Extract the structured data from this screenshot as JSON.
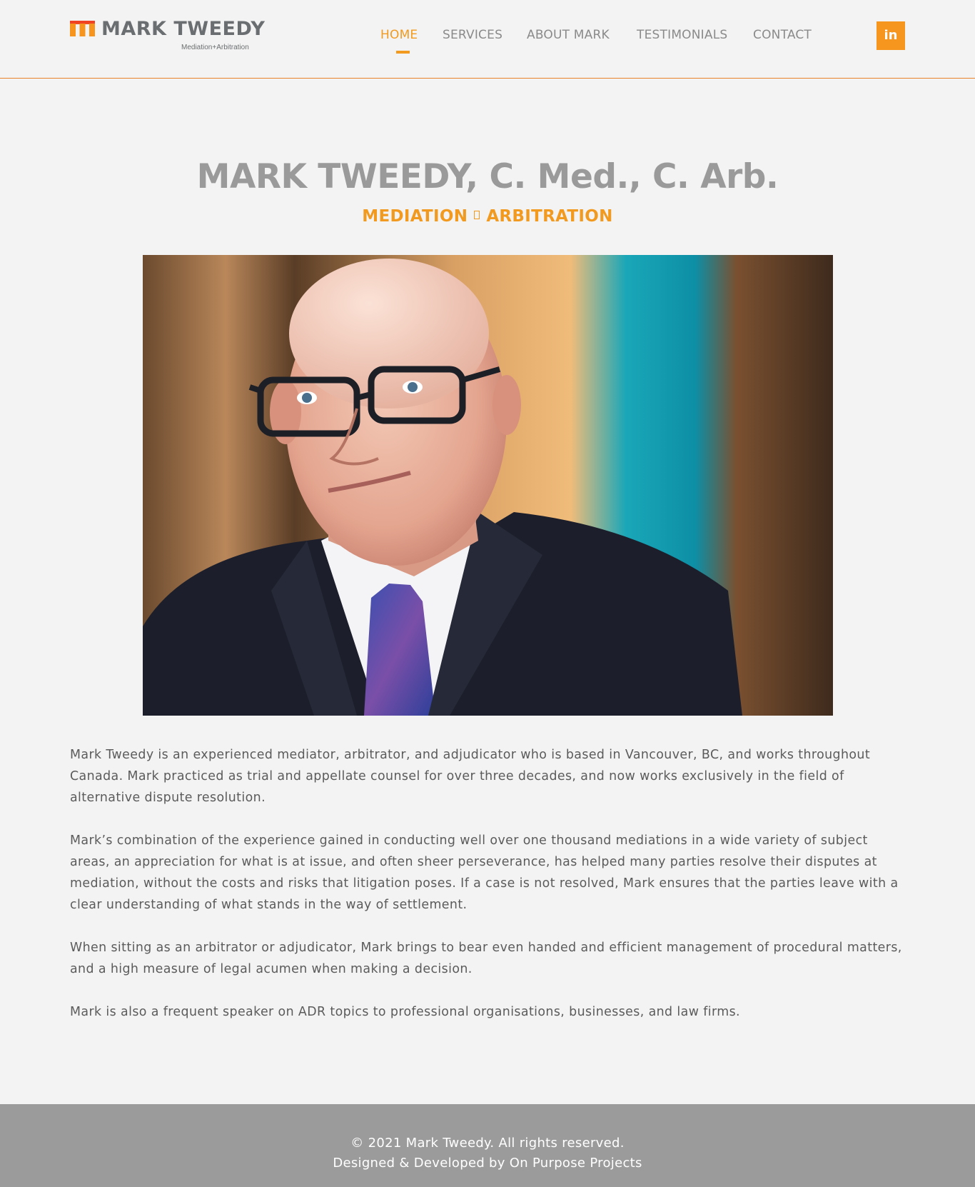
{
  "header": {
    "logo_text": "MARK TWEEDY",
    "logo_subtitle": "Mediation+Arbitration",
    "nav": [
      {
        "label": "HOME",
        "active": true
      },
      {
        "label": "SERVICES",
        "active": false
      },
      {
        "label": "ABOUT MARK",
        "active": false
      },
      {
        "label": "TESTIMONIALS",
        "active": false
      },
      {
        "label": "CONTACT",
        "active": false
      }
    ],
    "social_label": "in",
    "social_icon": "linkedin-icon"
  },
  "hero": {
    "title": "MARK TWEEDY, C. Med., C. Arb.",
    "subtitle_left": "MEDIATION",
    "subtitle_right": "ARBITRATION"
  },
  "bio": {
    "paragraphs": [
      "Mark Tweedy is an experienced mediator, arbitrator, and adjudicator who is based in Vancouver, BC, and works throughout Canada. Mark practiced as trial and appellate counsel for over three decades, and now works exclusively in the field of alternative dispute resolution.",
      "Mark’s combination of the experience gained in conducting well over one thousand mediations in a wide variety of subject areas, an appreciation for what is at issue, and often sheer perseverance, has helped many parties resolve their disputes at mediation, without the costs and risks that litigation poses. If a case is not resolved, Mark ensures that the parties leave with a clear understanding of what stands in the way of settlement.",
      "When sitting as an arbitrator or adjudicator, Mark brings to bear even handed and efficient management of procedural matters, and a high measure of legal acumen when making a decision.",
      "Mark is also a frequent speaker on ADR topics to professional organisations, businesses, and law firms."
    ]
  },
  "footer": {
    "copyright": "© 2021 Mark Tweedy. All rights reserved.",
    "credit": "Designed & Developed by On Purpose Projects"
  },
  "colors": {
    "accent": "#f29a1f",
    "header_rule": "#e8832a",
    "footer_bg": "#9b9b9b",
    "page_bg": "#f3f3f3"
  }
}
